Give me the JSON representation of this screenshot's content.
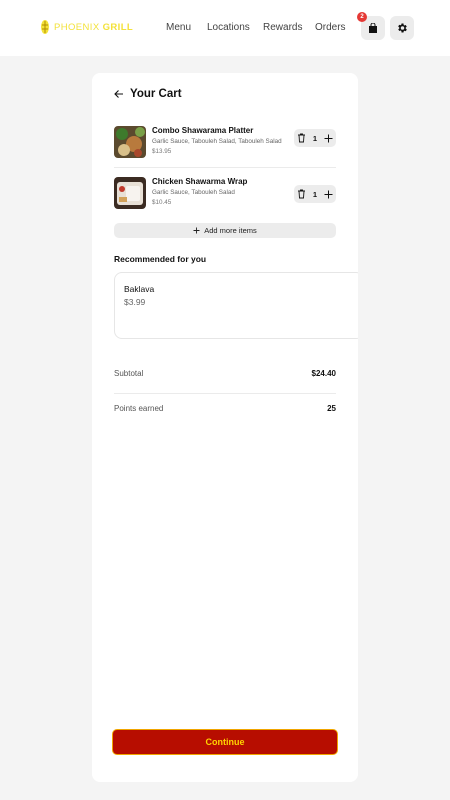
{
  "header": {
    "brand_part1": "PHOENIX",
    "brand_part2": "GRILL",
    "nav": [
      "Menu",
      "Locations",
      "Rewards",
      "Orders"
    ],
    "cart_count": "2",
    "cart_icon": "shopping-bag-icon",
    "settings_icon": "gear-icon",
    "brand_color": "#f3e23a"
  },
  "cart": {
    "back_icon": "arrow-left-icon",
    "title": "Your Cart",
    "items": [
      {
        "name": "Combo Shawarama Platter",
        "options": "Garlic Sauce, Tabouleh Salad, Tabouleh Salad",
        "price": "$13.95",
        "quantity": "1"
      },
      {
        "name": "Chicken Shawarma Wrap",
        "options": "Garlic Sauce, Tabouleh Salad",
        "price": "$10.45",
        "quantity": "1"
      }
    ],
    "add_more_label": "Add more items"
  },
  "recommended": {
    "title": "Recommended for you",
    "items": [
      {
        "name": "Baklava",
        "price": "$3.99"
      }
    ]
  },
  "summary": {
    "subtotal_label": "Subtotal",
    "subtotal_value": "$24.40",
    "points_label": "Points earned",
    "points_value": "25"
  },
  "actions": {
    "continue_label": "Continue",
    "primary_color": "#b70d00",
    "primary_text_color": "#ffd400"
  }
}
